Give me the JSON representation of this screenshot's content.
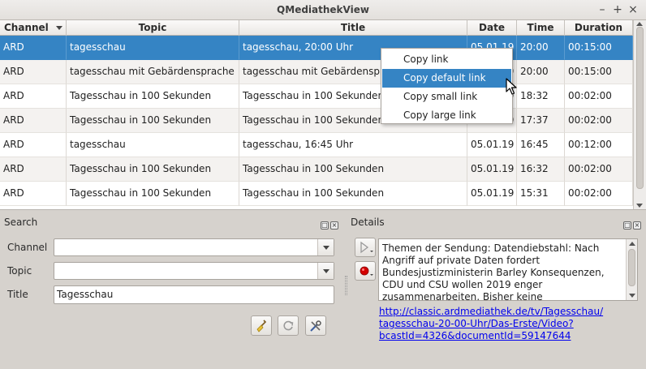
{
  "window": {
    "title": "QMediathekView"
  },
  "table": {
    "columns": [
      "Channel",
      "Topic",
      "Title",
      "Date",
      "Time",
      "Duration"
    ],
    "rows": [
      {
        "channel": "ARD",
        "topic": "tagesschau",
        "title": "tagesschau, 20:00 Uhr",
        "date": "05.01.19",
        "time": "20:00",
        "duration": "00:15:00"
      },
      {
        "channel": "ARD",
        "topic": "tagesschau mit Gebärdensprache",
        "title": "tagesschau mit Gebärdensprache",
        "date": "05.01.19",
        "time": "20:00",
        "duration": "00:15:00"
      },
      {
        "channel": "ARD",
        "topic": "Tagesschau in 100 Sekunden",
        "title": "Tagesschau in 100 Sekunden",
        "date": "05.01.19",
        "time": "18:32",
        "duration": "00:02:00"
      },
      {
        "channel": "ARD",
        "topic": "Tagesschau in 100 Sekunden",
        "title": "Tagesschau in 100 Sekunden",
        "date": "05.01.19",
        "time": "17:37",
        "duration": "00:02:00"
      },
      {
        "channel": "ARD",
        "topic": "tagesschau",
        "title": "tagesschau, 16:45 Uhr",
        "date": "05.01.19",
        "time": "16:45",
        "duration": "00:12:00"
      },
      {
        "channel": "ARD",
        "topic": "Tagesschau in 100 Sekunden",
        "title": "Tagesschau in 100 Sekunden",
        "date": "05.01.19",
        "time": "16:32",
        "duration": "00:02:00"
      },
      {
        "channel": "ARD",
        "topic": "Tagesschau in 100 Sekunden",
        "title": "Tagesschau in 100 Sekunden",
        "date": "05.01.19",
        "time": "15:31",
        "duration": "00:02:00"
      }
    ]
  },
  "context_menu": {
    "items": [
      "Copy link",
      "Copy default link",
      "Copy small link",
      "Copy large link"
    ],
    "highlighted": "Copy default link"
  },
  "search": {
    "title": "Search",
    "channel_label": "Channel",
    "channel_value": "",
    "topic_label": "Topic",
    "topic_value": "",
    "title_label": "Title",
    "title_value": "Tagesschau"
  },
  "details": {
    "title": "Details",
    "description": "Themen der Sendung: Datendiebstahl: Nach Angriff auf private Daten fordert Bundesjustizministerin Barley Konsequenzen, CDU und CSU wollen 2019 enger zusammenarbeiten, Bisher keine",
    "link": "http://classic.ardmediathek.de/tv/Tagesschau/tagesschau-20-00-Uhr/Das-Erste/Video?bcastId=4326&documentId=59147644"
  },
  "colors": {
    "selection": "#3584c4",
    "link": "#0000ee"
  }
}
